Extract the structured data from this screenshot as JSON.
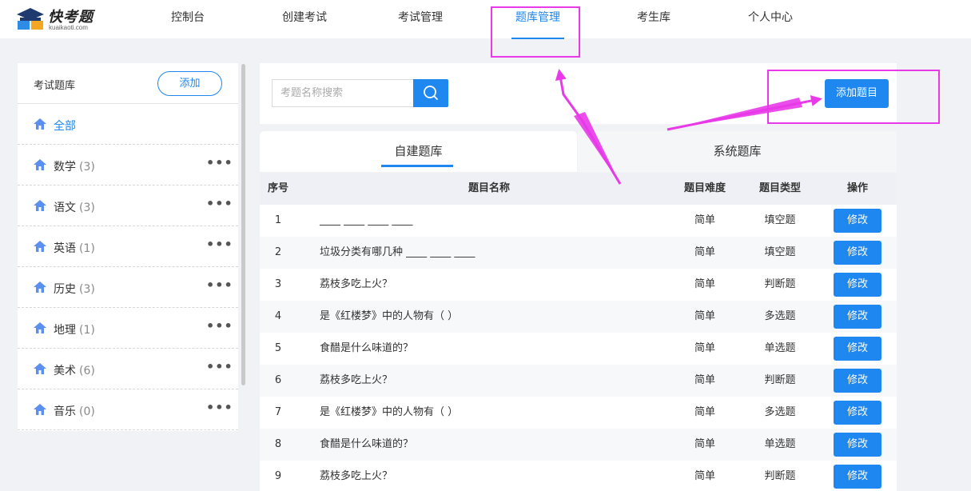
{
  "brand": {
    "name": "快考题",
    "domain": "kuaikaoti.com"
  },
  "nav": [
    {
      "label": "控制台"
    },
    {
      "label": "创建考试"
    },
    {
      "label": "考试管理"
    },
    {
      "label": "题库管理",
      "active": true
    },
    {
      "label": "考生库"
    },
    {
      "label": "个人中心"
    }
  ],
  "sidebar": {
    "title": "考试题库",
    "add_label": "添加",
    "items": [
      {
        "label": "全部",
        "count": "",
        "active": true
      },
      {
        "label": "数学",
        "count": "(3)"
      },
      {
        "label": "语文",
        "count": "(3)"
      },
      {
        "label": "英语",
        "count": "(1)"
      },
      {
        "label": "历史",
        "count": "(3)"
      },
      {
        "label": "地理",
        "count": "(1)"
      },
      {
        "label": "美术",
        "count": "(6)"
      },
      {
        "label": "音乐",
        "count": "(0)"
      }
    ],
    "more_label": "•••"
  },
  "search": {
    "placeholder": "考题名称搜索",
    "value": ""
  },
  "add_question_label": "添加题目",
  "tabs": [
    {
      "label": "自建题库",
      "active": true
    },
    {
      "label": "系统题库"
    }
  ],
  "table": {
    "headers": {
      "index": "序号",
      "name": "题目名称",
      "difficulty": "题目难度",
      "type": "题目类型",
      "action": "操作"
    },
    "edit_label": "修改",
    "rows": [
      {
        "index": "1",
        "name": "____ ____ ____ ____",
        "difficulty": "简单",
        "type": "填空题"
      },
      {
        "index": "2",
        "name": "垃圾分类有哪几种 ____ ____ ____",
        "difficulty": "简单",
        "type": "填空题"
      },
      {
        "index": "3",
        "name": "荔枝多吃上火？",
        "difficulty": "简单",
        "type": "判断题"
      },
      {
        "index": "4",
        "name": "是《红楼梦》中的人物有（    ）",
        "difficulty": "简单",
        "type": "多选题"
      },
      {
        "index": "5",
        "name": "食醋是什么味道的？",
        "difficulty": "简单",
        "type": "单选题"
      },
      {
        "index": "6",
        "name": "荔枝多吃上火？",
        "difficulty": "简单",
        "type": "判断题"
      },
      {
        "index": "7",
        "name": "是《红楼梦》中的人物有（    ）",
        "difficulty": "简单",
        "type": "多选题"
      },
      {
        "index": "8",
        "name": "食醋是什么味道的？",
        "difficulty": "简单",
        "type": "单选题"
      },
      {
        "index": "9",
        "name": "荔枝多吃上火？",
        "difficulty": "简单",
        "type": "判断题"
      }
    ]
  },
  "colors": {
    "accent": "#1e87f0",
    "annotation": "#e83ae8"
  }
}
